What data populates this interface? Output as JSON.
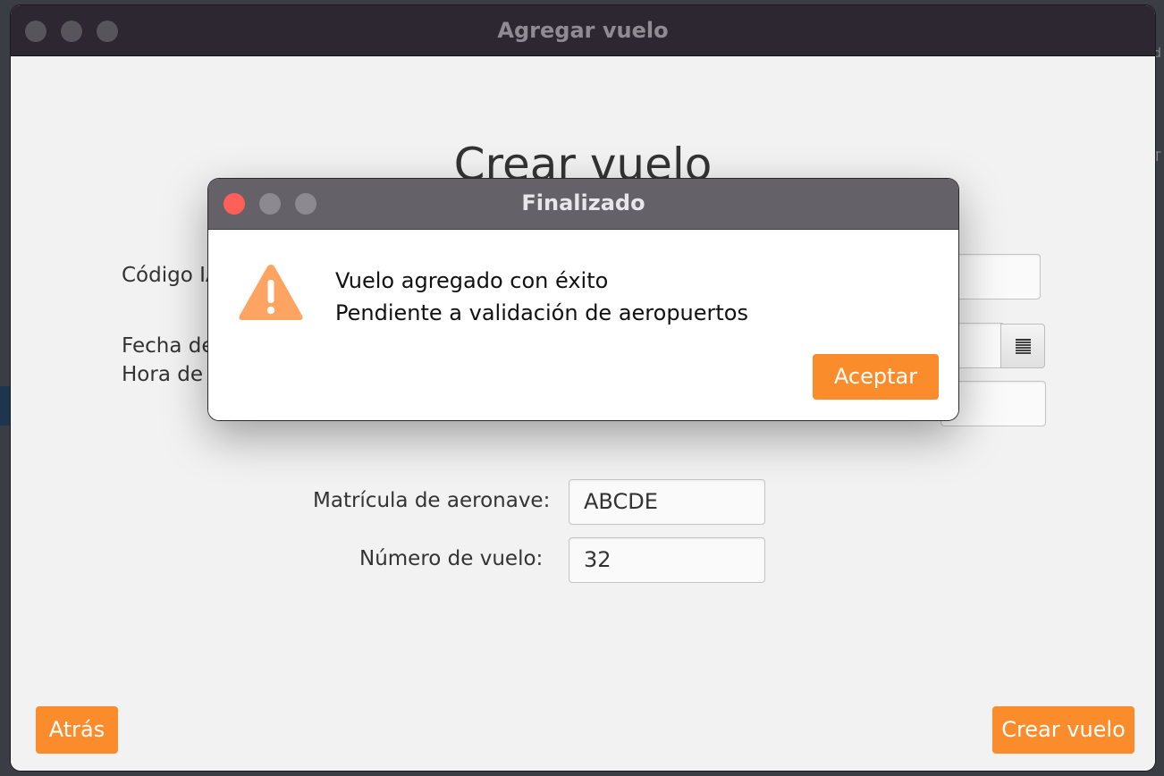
{
  "background_fragments": {
    "right_edge_char_1": "d",
    "right_edge_char_2": "T"
  },
  "main_window": {
    "title": "Agregar vuelo",
    "heading": "Crear vuelo",
    "labels": {
      "codigo_partial": "Código IA",
      "fecha_partial": "Fecha de",
      "hora_partial": "Hora de p",
      "matricula": "Matrícula de aeronave:",
      "numero": "Número de vuelo:"
    },
    "fields": {
      "matricula_value": "ABCDE",
      "numero_value": "32"
    },
    "buttons": {
      "back": "Atrás",
      "create": "Crear vuelo"
    },
    "accent_color": "#fb8c2c"
  },
  "dialog": {
    "title": "Finalizado",
    "icon": "warning-icon",
    "message_line1": "Vuelo agregado con éxito",
    "message_line2": "Pendiente a validación de aeropuertos",
    "ok_button": "Aceptar"
  }
}
